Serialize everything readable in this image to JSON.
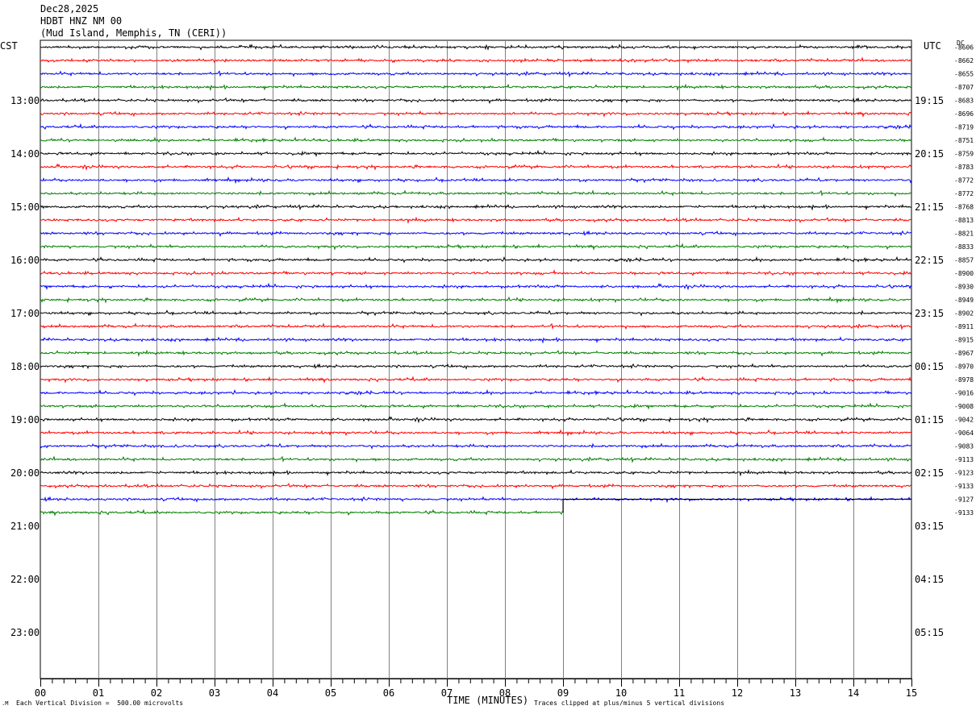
{
  "header": {
    "date": "Dec28,2025",
    "station": "HDBT HNZ NM 00",
    "location": "(Mud Island, Memphis, TN (CERI))"
  },
  "left_tz": "CST",
  "right_tz": "UTC",
  "dc_label": "DC",
  "footer": {
    "division_note": "Each Vertical Division =  500.00 microvolts",
    "xlabel": "TIME (MINUTES)",
    "clip_note": "Traces clipped at plus/minus 5 vertical divisions"
  },
  "chart_data": {
    "type": "line",
    "title": "HDBT HNZ NM 00",
    "xlabel": "TIME (MINUTES)",
    "x_ticks": [
      "00",
      "01",
      "02",
      "03",
      "04",
      "05",
      "06",
      "07",
      "08",
      "09",
      "10",
      "11",
      "12",
      "13",
      "14",
      "15"
    ],
    "xlim": [
      0,
      15
    ],
    "traces_per_hour": 4,
    "trace_minutes": 15,
    "last_trace_end_minute": 9,
    "trace_colors": [
      "#000000",
      "#ff0000",
      "#0000ff",
      "#007f00"
    ],
    "cst_hours": [
      "13:00",
      "14:00",
      "15:00",
      "16:00",
      "17:00",
      "18:00",
      "19:00",
      "20:00",
      "21:00",
      "22:00",
      "23:00"
    ],
    "utc_hours": [
      "19:15",
      "20:15",
      "21:15",
      "22:15",
      "23:15",
      "00:15",
      "01:15",
      "02:15",
      "03:15",
      "04:15",
      "05:15"
    ],
    "dc_offsets": [
      "-8606",
      "-8662",
      "-8655",
      "-8707",
      "-8683",
      "-8696",
      "-8719",
      "-8751",
      "-8759",
      "-8783",
      "-8772",
      "-8772",
      "-8768",
      "-8813",
      "-8821",
      "-8833",
      "-8857",
      "-8900",
      "-8930",
      "-8949",
      "-8902",
      "-8911",
      "-8915",
      "-8967",
      "-8970",
      "-8978",
      "-9016",
      "-9008",
      "-9042",
      "-9064",
      "-9083",
      "-9113",
      "-9123",
      "-9133",
      "-9127",
      "-9133"
    ]
  }
}
